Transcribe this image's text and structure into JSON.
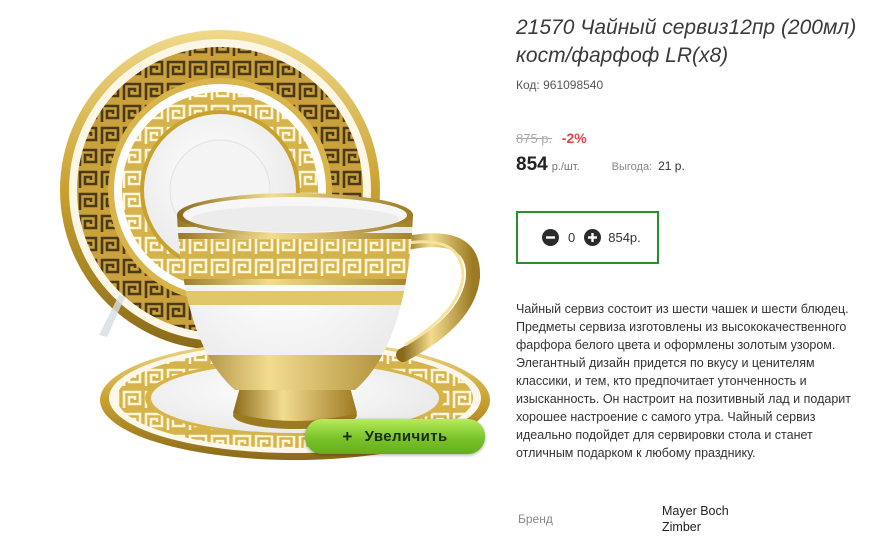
{
  "product": {
    "title": "21570 Чайный сервиз12пр (200мл) кост/фарфоф LR(x8)",
    "code_label": "Код:",
    "code_value": "961098540",
    "old_price": "875 р.",
    "discount": "-2%",
    "price": "854",
    "price_unit": "р./шт.",
    "benefit_label": "Выгода:",
    "benefit_value": "21 р.",
    "description": "Чайный сервиз состоит из шести чашек и шести блюдец. Предметы сервиза изготовлены из высококачественного фарфора белого цвета и оформлены золотым узором. Элегантный дизайн придется по вкусу и ценителям классики, и тем, кто предпочитает утонченность и изысканность. Он настроит на позитивный лад и подарит хорошее настроение с самого утра. Чайный сервиз идеально подойдет для сервировки стола и станет отличным подарком к любому празднику.",
    "brand_label": "Бренд",
    "brand_value": "Mayer Boch Zimber"
  },
  "cart": {
    "quantity": "0",
    "total": "854р.",
    "minus_icon": "minus-circle-icon",
    "plus_icon": "plus-circle-icon"
  },
  "image": {
    "zoom_plus": "+",
    "zoom_label": "Увеличить"
  },
  "colors": {
    "gold": "#c9a12f",
    "accent_green": "#2a8f2a",
    "zoom_button": "#86c93a",
    "discount_red": "#e8444a"
  }
}
